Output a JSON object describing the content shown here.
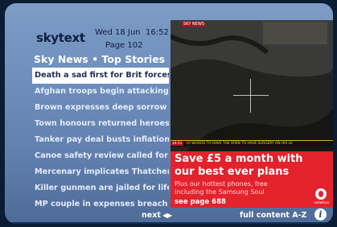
{
  "header": {
    "logo": "skytext",
    "date": "Wed 18 Jun",
    "time": "16:52",
    "page": "Page 102"
  },
  "section_title": "Sky News • Top Stories",
  "headlines": [
    {
      "label": "Death a sad first for Brit forces",
      "selected": true
    },
    {
      "label": "Afghan troops begin attacking",
      "selected": false
    },
    {
      "label": "Brown expresses deep sorrow",
      "selected": false
    },
    {
      "label": "Town honours returned heroes",
      "selected": false
    },
    {
      "label": "Tanker pay deal busts inflation",
      "selected": false
    },
    {
      "label": "Canoe safety review called for",
      "selected": false
    },
    {
      "label": "Mercenary implicates Thatcher",
      "selected": false
    },
    {
      "label": "Killer gunmen are jailed for life",
      "selected": false
    },
    {
      "label": "MP couple in expenses breach",
      "selected": false
    }
  ],
  "navigation": {
    "next_label": "next",
    "full_content_label": "full content A-Z"
  },
  "video": {
    "channel_bug": "SKY NEWS",
    "ticker_time": "16:51",
    "ticker_text": "10 WOODS TO HAVE THE OPEN TO HAVE SURGERY ON HIS LE"
  },
  "advert": {
    "headline_line1": "Save £5 a month with",
    "headline_line2": "our best ever plans",
    "body_line1": "Plus our hottest phones, free",
    "body_line2": "including the Samsung Soul",
    "cta": "see page 688",
    "brand": "vodafone"
  },
  "colors": {
    "panel_gradient_top": "#7d9cc6",
    "selected_row_bg": "#ffffff",
    "advert_red": "#e3222c",
    "text_dark": "#0f1e3d"
  }
}
